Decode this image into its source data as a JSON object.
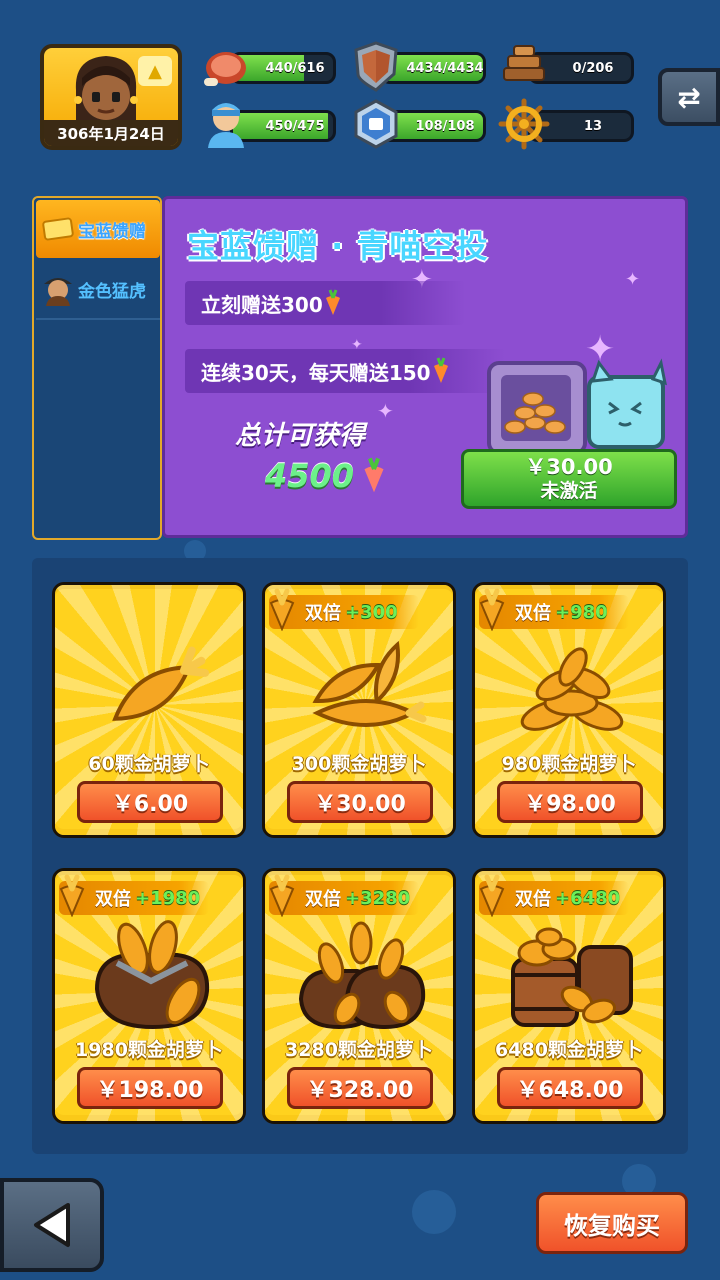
{
  "header": {
    "date": "306年1月24日",
    "stats": [
      {
        "name": "food",
        "text": "440/616",
        "fill": 0.714
      },
      {
        "name": "shield",
        "text": "4434/4434",
        "fill": 1.0
      },
      {
        "name": "wood",
        "text": "0/206",
        "fill": 0.0
      },
      {
        "name": "population",
        "text": "450/475",
        "fill": 0.947
      },
      {
        "name": "defense",
        "text": "108/108",
        "fill": 1.0
      },
      {
        "name": "wheel",
        "text": "13",
        "fill": 0.0
      }
    ]
  },
  "tabs": [
    {
      "label": "宝蓝馈赠",
      "active": true
    },
    {
      "label": "金色猛虎",
      "active": false
    }
  ],
  "promo": {
    "title": "宝蓝馈赠 · 青喵空投",
    "line1": "立刻赠送300",
    "line2": "连续30天，每天赠送150",
    "total_label": "总计可获得",
    "total_value": "4500",
    "price": "￥30.00",
    "status": "未激活"
  },
  "shop": {
    "items": [
      {
        "label": "60颗金胡萝卜",
        "price": "￥6.00",
        "badge": "",
        "bonus": ""
      },
      {
        "label": "300颗金胡萝卜",
        "price": "￥30.00",
        "badge": "双倍",
        "bonus": "+300"
      },
      {
        "label": "980颗金胡萝卜",
        "price": "￥98.00",
        "badge": "双倍",
        "bonus": "+980"
      },
      {
        "label": "1980颗金胡萝卜",
        "price": "￥198.00",
        "badge": "双倍",
        "bonus": "+1980"
      },
      {
        "label": "3280颗金胡萝卜",
        "price": "￥328.00",
        "badge": "双倍",
        "bonus": "+3280"
      },
      {
        "label": "6480颗金胡萝卜",
        "price": "￥648.00",
        "badge": "双倍",
        "bonus": "+6480"
      }
    ]
  },
  "footer": {
    "restore_label": "恢复购买"
  },
  "colors": {
    "background": "#1d4f86",
    "promo": "#8d4ed1",
    "card": "#ffd21e",
    "price_button": "#f0522a",
    "activate_button": "#3ba62b",
    "stat_fill": "#3ba62b"
  },
  "icons": [
    "meat-icon",
    "shield-icon",
    "wood-icon",
    "worker-icon",
    "defense-badge-icon",
    "ship-wheel-icon",
    "swap-icon",
    "carrot-icon",
    "back-arrow-icon"
  ]
}
